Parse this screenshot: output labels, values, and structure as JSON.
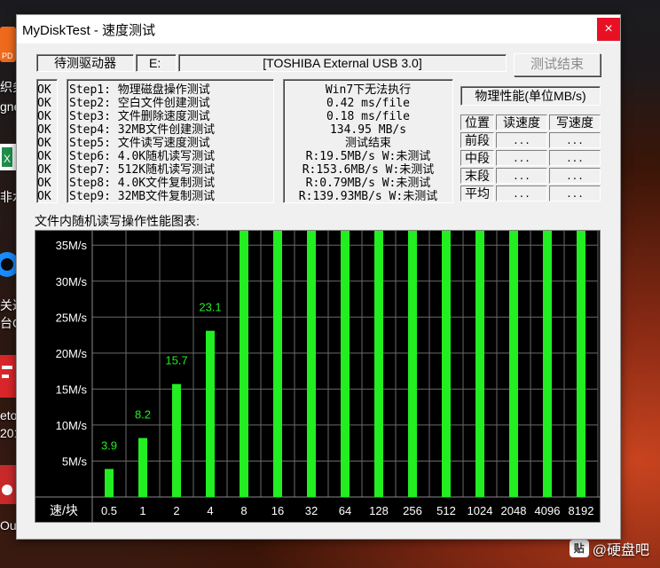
{
  "desktop": {
    "left_labels": [
      "织务",
      "gne",
      "非水",
      "关达",
      "台C",
      "eto",
      "201",
      "Out"
    ],
    "watermark": "@硬盘吧",
    "watermark_badge": "贴"
  },
  "window": {
    "title": "MyDiskTest - 速度测试",
    "close_symbol": "×"
  },
  "drive": {
    "label": "待测驱动器",
    "letter": "E:",
    "name": "[TOSHIBA External USB 3.0]"
  },
  "end_button": "测试结束",
  "steps": [
    {
      "status": "OK",
      "name": "Step1: 物理磁盘操作测试",
      "result": "Win7下无法执行"
    },
    {
      "status": "OK",
      "name": "Step2: 空白文件创建测试",
      "result": "0.42 ms/file"
    },
    {
      "status": "OK",
      "name": "Step3: 文件删除速度测试",
      "result": "0.18 ms/file"
    },
    {
      "status": "OK",
      "name": "Step4: 32MB文件创建测试",
      "result": "134.95 MB/s"
    },
    {
      "status": "OK",
      "name": "Step5: 文件读写速度测试",
      "result": "测试结束"
    },
    {
      "status": "OK",
      "name": "Step6: 4.0K随机读写测试",
      "result": "R:19.5MB/s W:未测试"
    },
    {
      "status": "OK",
      "name": "Step7: 512K随机读写测试",
      "result": "R:153.6MB/s W:未测试"
    },
    {
      "status": "OK",
      "name": "Step8: 4.0K文件复制测试",
      "result": "R:0.79MB/s W:未测试"
    },
    {
      "status": "OK",
      "name": "Step9: 32MB文件复制测试",
      "result": "R:139.93MB/s W:未测试"
    }
  ],
  "perf": {
    "title": "物理性能(单位MB/s)",
    "headers": [
      "位置",
      "读速度",
      "写速度"
    ],
    "rows": [
      {
        "pos": "前段",
        "read": "...",
        "write": "..."
      },
      {
        "pos": "中段",
        "read": "...",
        "write": "..."
      },
      {
        "pos": "末段",
        "read": "...",
        "write": "..."
      },
      {
        "pos": "平均",
        "read": "...",
        "write": "..."
      }
    ]
  },
  "chart_title": "文件内随机读写操作性能图表:",
  "chart_data": {
    "type": "bar",
    "xlabel": "速/块",
    "categories": [
      "0.5",
      "1",
      "2",
      "4",
      "8",
      "16",
      "32",
      "64",
      "128",
      "256",
      "512",
      "1024",
      "2048",
      "4096",
      "8192"
    ],
    "values": [
      3.9,
      8.2,
      15.7,
      23.1,
      37,
      37,
      37,
      37,
      37,
      37,
      37,
      37,
      37,
      37,
      37
    ],
    "data_labels": [
      "3.9",
      "8.2",
      "15.7",
      "23.1",
      "",
      "",
      "",
      "",
      "",
      "",
      "",
      "",
      "",
      "",
      ""
    ],
    "y_ticks": [
      "5M/s",
      "10M/s",
      "15M/s",
      "20M/s",
      "25M/s",
      "30M/s",
      "35M/s"
    ],
    "y_tick_values": [
      5,
      10,
      15,
      20,
      25,
      30,
      35
    ],
    "ylim": [
      0,
      37
    ],
    "bar_color": "#22ee22",
    "background": "#000000",
    "grid": true
  }
}
